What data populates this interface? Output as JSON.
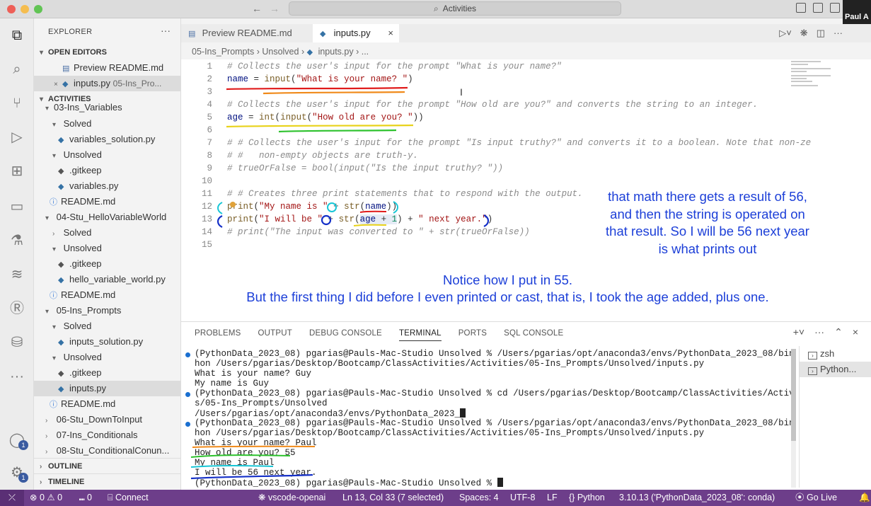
{
  "window": {
    "title": "Activities",
    "user": "Paul A"
  },
  "activity_bar": {
    "badges": [
      "1",
      "1"
    ]
  },
  "sidebar": {
    "title": "EXPLORER",
    "more": "···",
    "open_editors": {
      "heading": "OPEN EDITORS",
      "items": [
        {
          "label": "Preview README.md"
        },
        {
          "label": "inputs.py",
          "path": "05-Ins_Pro..."
        }
      ]
    },
    "activities_heading": "ACTIVITIES",
    "tree": [
      {
        "label": "03-Ins_Variables"
      },
      {
        "label": "Solved"
      },
      {
        "label": "variables_solution.py"
      },
      {
        "label": "Unsolved"
      },
      {
        "label": ".gitkeep"
      },
      {
        "label": "variables.py"
      },
      {
        "label": "README.md"
      },
      {
        "label": "04-Stu_HelloVariableWorld"
      },
      {
        "label": "Solved"
      },
      {
        "label": "Unsolved"
      },
      {
        "label": ".gitkeep"
      },
      {
        "label": "hello_variable_world.py"
      },
      {
        "label": "README.md"
      },
      {
        "label": "05-Ins_Prompts"
      },
      {
        "label": "Solved"
      },
      {
        "label": "inputs_solution.py"
      },
      {
        "label": "Unsolved"
      },
      {
        "label": ".gitkeep"
      },
      {
        "label": "inputs.py"
      },
      {
        "label": "README.md"
      },
      {
        "label": "06-Stu_DownToInput"
      },
      {
        "label": "07-Ins_Conditionals"
      },
      {
        "label": "08-Stu_ConditionalConun..."
      }
    ],
    "outline": "OUTLINE",
    "timeline": "TIMELINE"
  },
  "tabs": [
    {
      "label": "Preview README.md"
    },
    {
      "label": "inputs.py",
      "close": "×"
    }
  ],
  "breadcrumb": {
    "a": "05-Ins_Prompts",
    "b": "Unsolved",
    "c": "inputs.py",
    "d": "..."
  },
  "editor": {
    "line_numbers": [
      "1",
      "2",
      "3",
      "4",
      "5",
      "6",
      "7",
      "8",
      "9",
      "10",
      "11",
      "12",
      "13",
      "14",
      "15"
    ],
    "lines": {
      "l1": "# Collects the user's input for the prompt \"What is your name?\"",
      "l2a": "name",
      "l2b": " = ",
      "l2c": "input",
      "l2d": "(",
      "l2e": "\"What is your name? \"",
      "l2f": ")",
      "l4": "# Collects the user's input for the prompt \"How old are you?\" and converts the string to an integer.",
      "l5a": "age",
      "l5b": " = ",
      "l5c": "int",
      "l5d": "(",
      "l5e": "input",
      "l5f": "(",
      "l5g": "\"How old are you? \"",
      "l5h": "))",
      "l7": "# # Collects the user's input for the prompt \"Is input truthy?\" and converts it to a boolean. Note that non-ze",
      "l8": "# #   non-empty objects are truth-y.",
      "l9": "# trueOrFalse = bool(input(\"Is the input truthy? \"))",
      "l11": "# # Creates three print statements that to respond with the output.",
      "l12a": "print",
      "l12b": "(",
      "l12c": "\"My name is \"",
      "l12d": " + ",
      "l12e": "str",
      "l12f": "(",
      "l12g": "name",
      "l12h": "))",
      "l13a": "print",
      "l13b": "(",
      "l13c": "\"I will be \"",
      "l13d": " + ",
      "l13e": "str",
      "l13f": "(",
      "l13g": "age",
      "l13h": " + ",
      "l13i": "1",
      "l13j": ")",
      "l13k": " + ",
      "l13l": "\" next year.\"",
      "l13m": ")",
      "l14": "# print(\"The input was converted to \" + str(trueOrFalse))"
    }
  },
  "annotations": {
    "right": [
      "that math there gets a result of 56,",
      "and then the string is operated on",
      "that result. So I will be 56 next year",
      "is what prints out"
    ],
    "bottom": [
      "Notice how I put in 55.",
      "But the first thing I did before I even printed or cast, that is, I took the age added, plus one."
    ]
  },
  "panel": {
    "tabs": [
      "PROBLEMS",
      "OUTPUT",
      "DEBUG CONSOLE",
      "TERMINAL",
      "PORTS",
      "SQL CONSOLE"
    ],
    "active_tab": "TERMINAL",
    "terminal_lines": [
      "(PythonData_2023_08) pgarias@Pauls-Mac-Studio Unsolved % /Users/pgarias/opt/anaconda3/envs/PythonData_2023_08/bin/pyt",
      "hon /Users/pgarias/Desktop/Bootcamp/ClassActivities/Activities/05-Ins_Prompts/Unsolved/inputs.py",
      "What is your name? Guy",
      "My name is Guy",
      "(PythonData_2023_08) pgarias@Pauls-Mac-Studio Unsolved % cd /Users/pgarias/Desktop/Bootcamp/ClassActivities/Activitie",
      "s/05-Ins_Prompts/Unsolved",
      "/Users/pgarias/opt/anaconda3/envs/PythonData_2023_",
      "(PythonData_2023_08) pgarias@Pauls-Mac-Studio Unsolved % /Users/pgarias/opt/anaconda3/envs/PythonData_2023_08/bin/pyt",
      "hon /Users/pgarias/Desktop/Bootcamp/ClassActivities/Activities/05-Ins_Prompts/Unsolved/inputs.py",
      "What is your name? Paul",
      "How old are you? 55",
      "My name is Paul",
      "I will be 56 next year.",
      "(PythonData_2023_08) pgarias@Pauls-Mac-Studio Unsolved % "
    ],
    "terminals": [
      {
        "label": "zsh"
      },
      {
        "label": "Python..."
      }
    ]
  },
  "statusbar": {
    "errors": "0",
    "warnings": "0",
    "ports": "0",
    "connect": "Connect",
    "branch": "vscode-openai",
    "position": "Ln 13, Col 33 (7 selected)",
    "spaces": "Spaces: 4",
    "encoding": "UTF-8",
    "eol": "LF",
    "language": "Python",
    "interpreter": "3.10.13 ('PythonData_2023_08': conda)",
    "golive": "Go Live"
  },
  "colors": {
    "status_bar": "#6d3e8a",
    "annotation_text": "#1c3fd8",
    "mark_red": "#e01b1b",
    "mark_orange": "#f08a1a",
    "mark_yellow": "#e8d21a",
    "mark_green": "#2ec22e",
    "mark_cyan": "#18c6d6",
    "mark_blue": "#1530c8"
  }
}
